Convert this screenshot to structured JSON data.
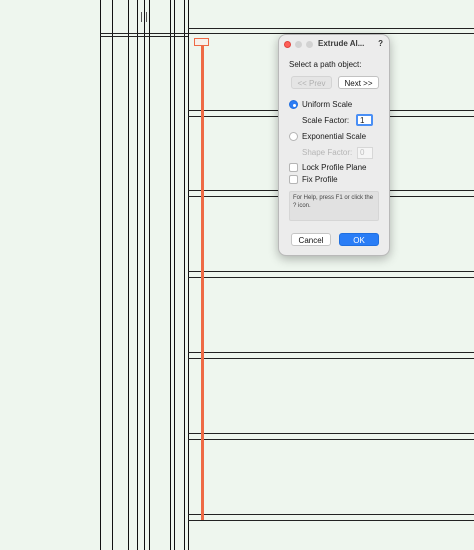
{
  "dialog": {
    "title": "Extrude Al...",
    "help_icon": "?",
    "prompt": "Select a path object:",
    "prev_label": "<< Prev",
    "next_label": "Next >>",
    "uniform_scale_label": "Uniform Scale",
    "uniform_scale_selected": true,
    "scale_factor_label": "Scale Factor:",
    "scale_factor_value": "1",
    "exponential_scale_label": "Exponential Scale",
    "shape_factor_label": "Shape Factor:",
    "shape_factor_value": "0",
    "lock_profile_plane_label": "Lock Profile Plane",
    "fix_profile_label": "Fix Profile",
    "help_text": "For Help, press F1 or click the ? icon.",
    "cancel_label": "Cancel",
    "ok_label": "OK"
  },
  "colors": {
    "canvas_background": "#eef6ee",
    "path_highlight": "#ee6a45",
    "accent_blue": "#2a7df6",
    "close_red": "#ff5f57"
  }
}
